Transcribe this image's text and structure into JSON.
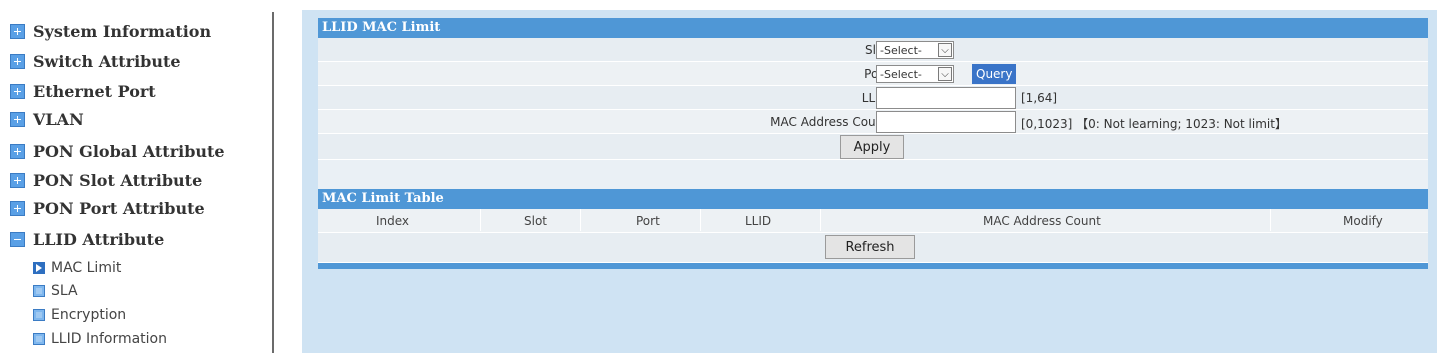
{
  "sidebar": {
    "items": [
      {
        "label": "System Information"
      },
      {
        "label": "Switch Attribute"
      },
      {
        "label": "Ethernet Port"
      },
      {
        "label": "VLAN"
      },
      {
        "label": "PON Global Attribute"
      },
      {
        "label": "PON Slot Attribute"
      },
      {
        "label": "PON Port Attribute"
      },
      {
        "label": "LLID Attribute"
      }
    ],
    "subitems": [
      {
        "label": "MAC Limit",
        "icon": "arrow-right-icon"
      },
      {
        "label": "SLA",
        "icon": "square-icon"
      },
      {
        "label": "Encryption",
        "icon": "square-icon"
      },
      {
        "label": "LLID Information",
        "icon": "square-icon"
      }
    ]
  },
  "form": {
    "title": "LLID MAC Limit",
    "slot_label": "Slot:",
    "slot_value": "-Select-",
    "port_label": "Port:",
    "port_value": "-Select-",
    "query_label": "Query",
    "llid_label": "LLID:",
    "llid_value": "",
    "llid_hint": "[1,64]",
    "mac_count_label": "MAC Address Count:",
    "mac_count_value": "",
    "mac_count_hint": "[0,1023] 【0: Not learning; 1023: Not limit】",
    "apply_label": "Apply"
  },
  "table": {
    "title": "MAC Limit Table",
    "columns": [
      "Index",
      "Slot",
      "Port",
      "LLID",
      "MAC Address Count",
      "Modify"
    ],
    "rows": [],
    "refresh_label": "Refresh"
  },
  "colors": {
    "accent": "#4f97d6",
    "background": "#cfe3f3",
    "query_button": "#3a74c8"
  }
}
